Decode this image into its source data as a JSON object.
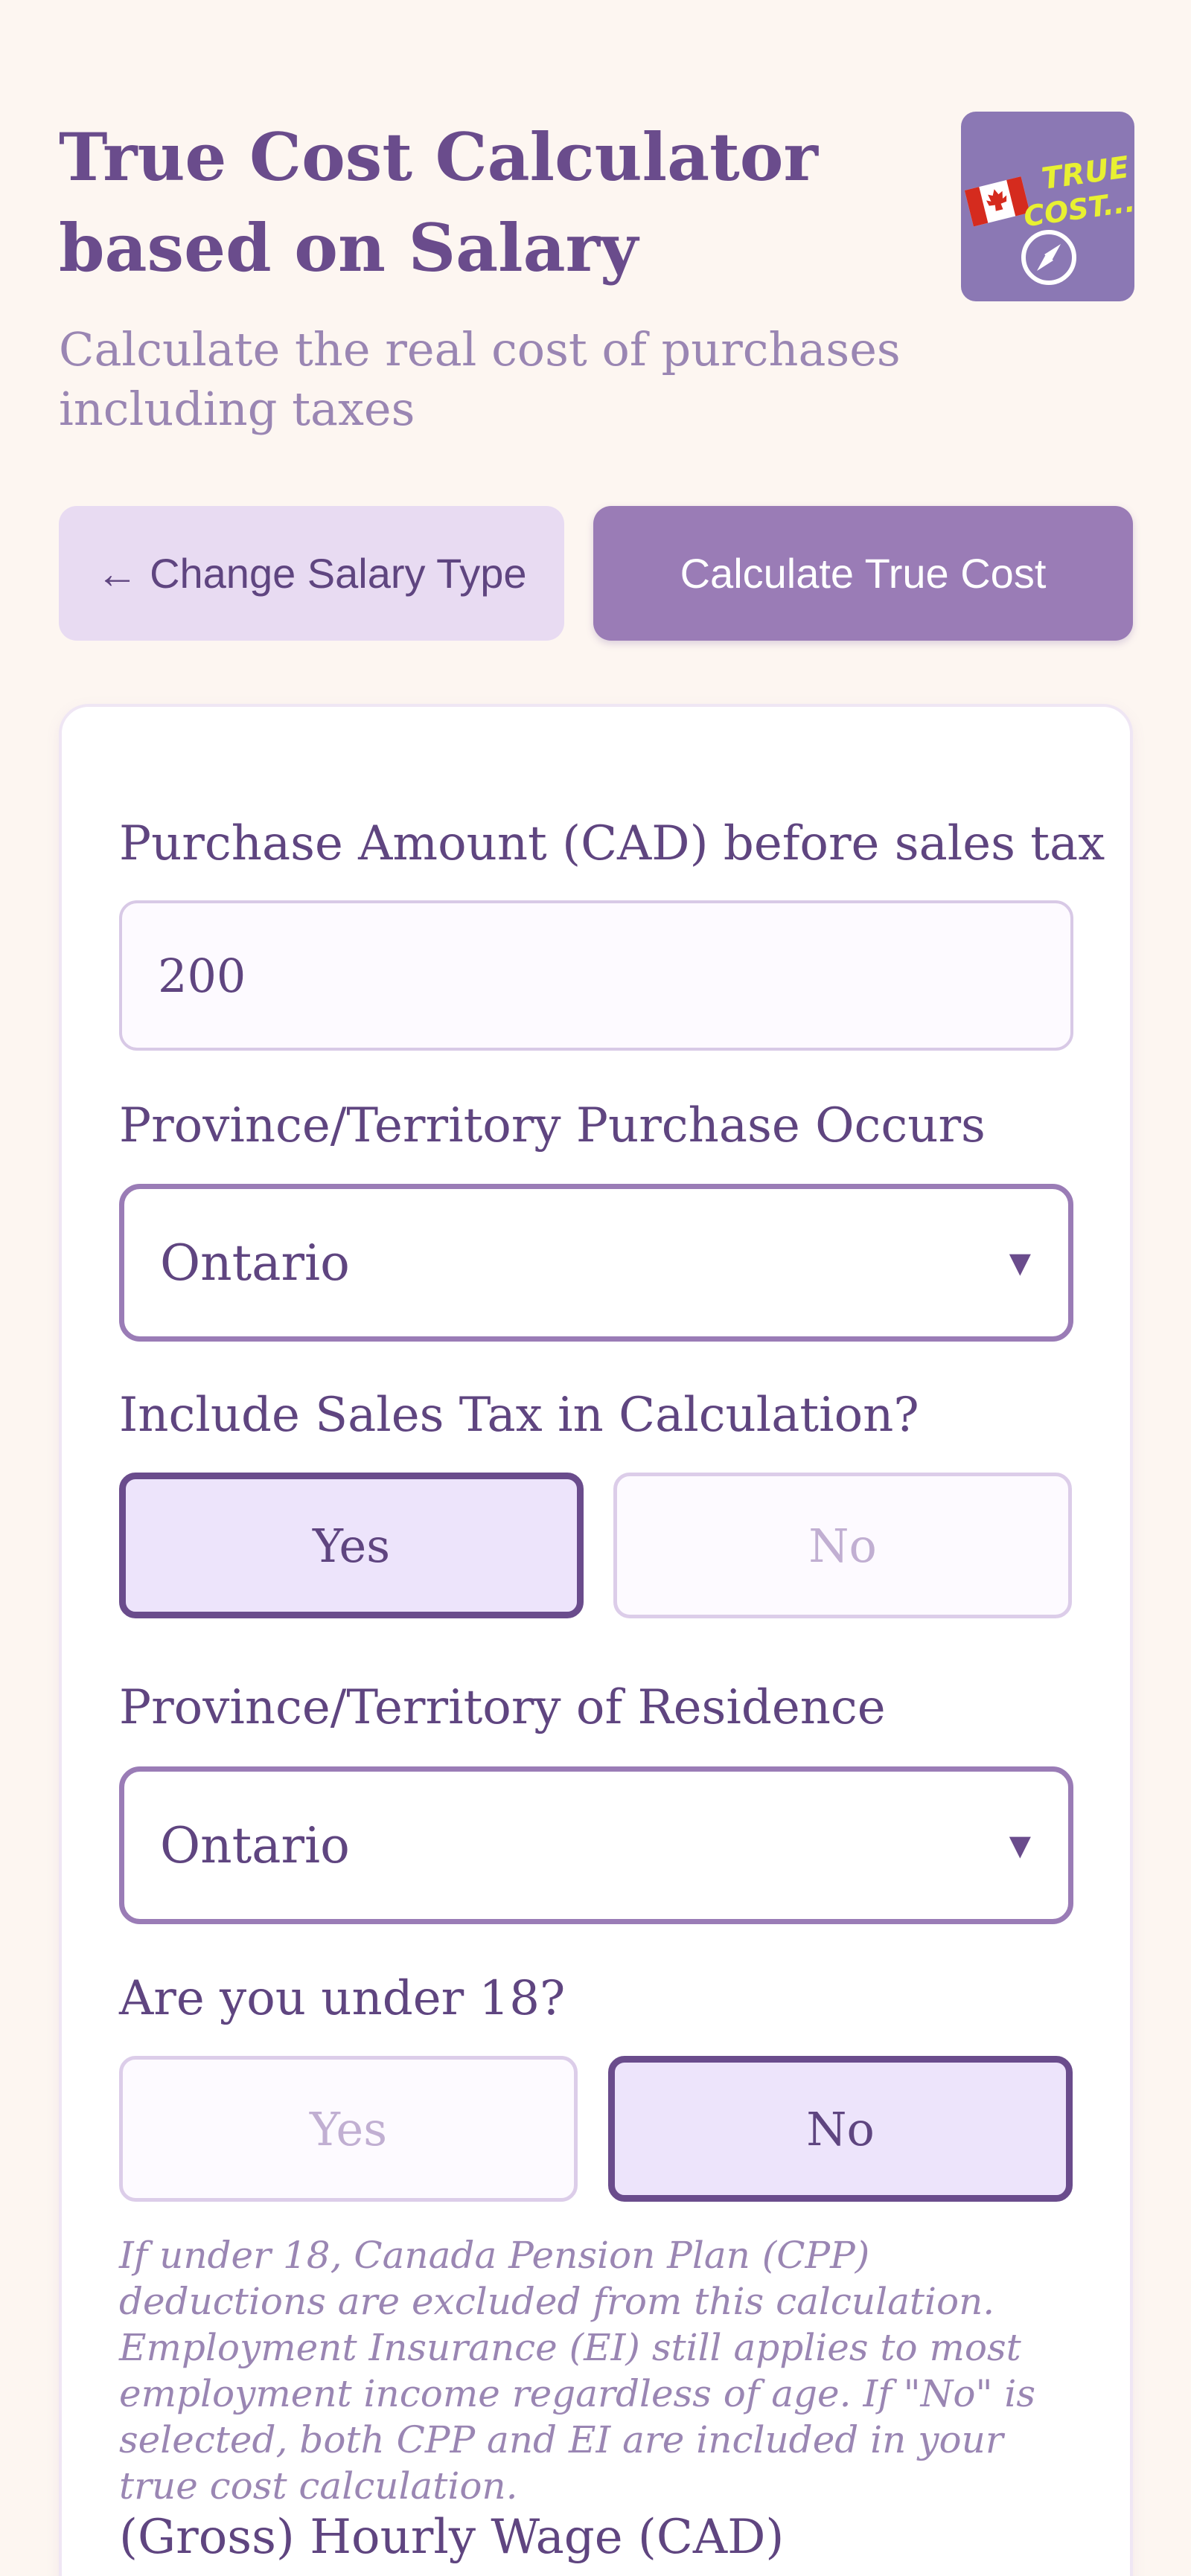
{
  "header": {
    "title": "True Cost Calculator based on Salary",
    "subtitle": "Calculate the real cost of purchases including taxes",
    "logo_text_line1": "TRUE",
    "logo_text_line2": "COST...",
    "logo_icons": [
      "canada-flag-icon",
      "compass-icon"
    ]
  },
  "actions": {
    "change_salary_label": "← Change Salary Type",
    "calculate_label": "Calculate True Cost"
  },
  "form": {
    "purchase_amount": {
      "label": "Purchase Amount (CAD) before sales tax",
      "value": "200"
    },
    "purchase_province": {
      "label": "Province/Territory Purchase Occurs",
      "value": "Ontario"
    },
    "include_sales_tax": {
      "label": "Include Sales Tax in Calculation?",
      "yes": "Yes",
      "no": "No",
      "selected": "Yes"
    },
    "residence_province": {
      "label": "Province/Territory of Residence",
      "value": "Ontario"
    },
    "under_18": {
      "label": "Are you under 18?",
      "yes": "Yes",
      "no": "No",
      "selected": "No",
      "note": "If under 18, Canada Pension Plan (CPP) deductions are excluded from this calculation. Employment Insurance (EI) still applies to most employment income regardless of age. If \"No\" is selected, both CPP and EI are included in your true cost calculation."
    },
    "hourly_wage": {
      "label": "(Gross) Hourly Wage (CAD)"
    }
  },
  "colors": {
    "background": "#fdf6f1",
    "primary": "#9a7cb6",
    "text": "#5f4580",
    "logo_bg": "#8b78b4",
    "logo_text": "#e8f032"
  }
}
